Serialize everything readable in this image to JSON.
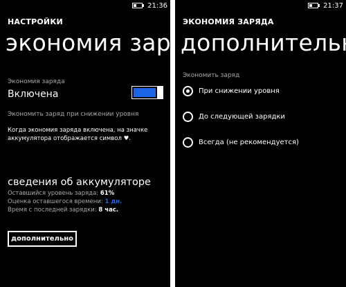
{
  "left": {
    "status": {
      "time": "21:36"
    },
    "app_title": "НАСТРОЙКИ",
    "page_title": "экономия заряда",
    "saver_label": "Экономия заряда",
    "saver_state": "Включена",
    "toggle": {
      "on": true,
      "accent": "#1b66e6"
    },
    "saver_hint": "Экономить заряд при снижении уровня",
    "note": "Когда экономия заряда включена, на значке аккумулятора отображается символ ♥.",
    "battery_section": {
      "title": "сведения об аккумуляторе",
      "rows": [
        {
          "label": "Оставшийся уровень заряда:",
          "value": "61%"
        },
        {
          "label": "Оценка оставшегося времени:",
          "value": "1 дн."
        },
        {
          "label": "Время с последней зарядки:",
          "value": "8 час."
        }
      ]
    },
    "advanced_button": "дополнительно"
  },
  "right": {
    "status": {
      "time": "21:37"
    },
    "app_title": "ЭКОНОМИЯ ЗАРЯДА",
    "page_title": "дополнительно",
    "group_label": "Экономить заряд",
    "options": [
      {
        "label": "При снижении уровня",
        "selected": true
      },
      {
        "label": "До следующей зарядки",
        "selected": false
      },
      {
        "label": "Всегда (не рекомендуется)",
        "selected": false
      }
    ]
  }
}
